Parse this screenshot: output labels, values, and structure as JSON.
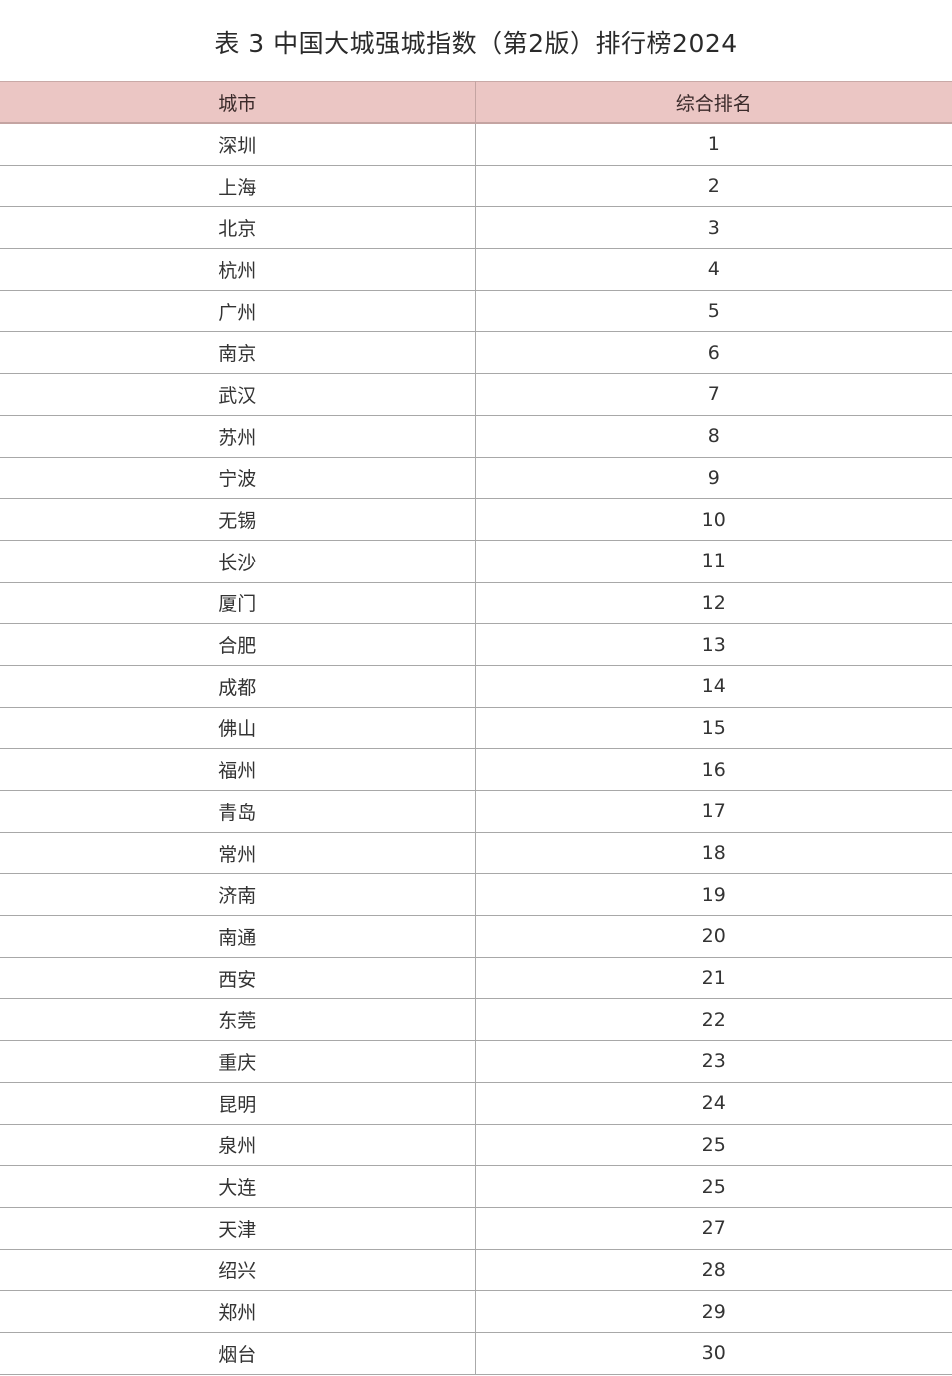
{
  "title": "表 3 中国大城强城指数（第2版）排行榜2024",
  "table": {
    "headers": [
      "城市",
      "综合排名"
    ],
    "rows": [
      {
        "city": "深圳",
        "rank": "1"
      },
      {
        "city": "上海",
        "rank": "2"
      },
      {
        "city": "北京",
        "rank": "3"
      },
      {
        "city": "杭州",
        "rank": "4"
      },
      {
        "city": "广州",
        "rank": "5"
      },
      {
        "city": "南京",
        "rank": "6"
      },
      {
        "city": "武汉",
        "rank": "7"
      },
      {
        "city": "苏州",
        "rank": "8"
      },
      {
        "city": "宁波",
        "rank": "9"
      },
      {
        "city": "无锡",
        "rank": "10"
      },
      {
        "city": "长沙",
        "rank": "11"
      },
      {
        "city": "厦门",
        "rank": "12"
      },
      {
        "city": "合肥",
        "rank": "13"
      },
      {
        "city": "成都",
        "rank": "14"
      },
      {
        "city": "佛山",
        "rank": "15"
      },
      {
        "city": "福州",
        "rank": "16"
      },
      {
        "city": "青岛",
        "rank": "17"
      },
      {
        "city": "常州",
        "rank": "18"
      },
      {
        "city": "济南",
        "rank": "19"
      },
      {
        "city": "南通",
        "rank": "20"
      },
      {
        "city": "西安",
        "rank": "21"
      },
      {
        "city": "东莞",
        "rank": "22"
      },
      {
        "city": "重庆",
        "rank": "23"
      },
      {
        "city": "昆明",
        "rank": "24"
      },
      {
        "city": "泉州",
        "rank": "25"
      },
      {
        "city": "大连",
        "rank": "25"
      },
      {
        "city": "天津",
        "rank": "27"
      },
      {
        "city": "绍兴",
        "rank": "28"
      },
      {
        "city": "郑州",
        "rank": "29"
      },
      {
        "city": "烟台",
        "rank": "30"
      }
    ]
  },
  "colors": {
    "header_bg": "#ebc6c4",
    "row_border": "#a8a8a8"
  }
}
